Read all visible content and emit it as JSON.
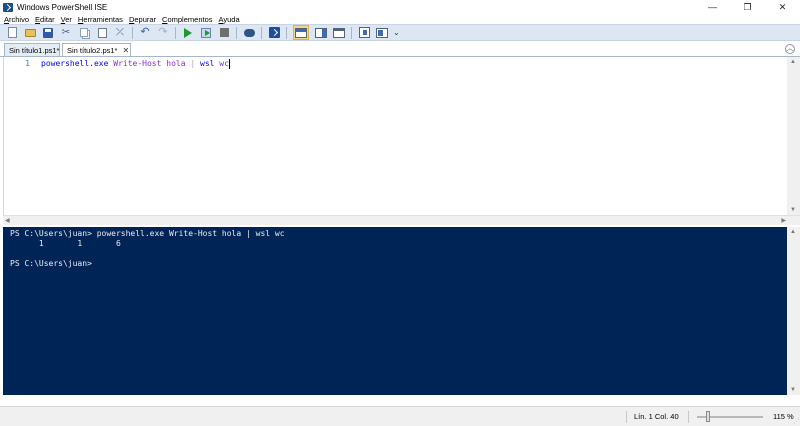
{
  "window": {
    "title": "Windows PowerShell ISE",
    "controls": [
      "—",
      "❐",
      "✕"
    ]
  },
  "menu": {
    "items": [
      {
        "underlined": "A",
        "rest": "rchivo"
      },
      {
        "underlined": "E",
        "rest": "ditar"
      },
      {
        "underlined": "V",
        "rest": "er"
      },
      {
        "underlined": "H",
        "rest": "erramientas"
      },
      {
        "underlined": "D",
        "rest": "epurar"
      },
      {
        "underlined": "C",
        "rest": "omplementos"
      },
      {
        "underlined": "A",
        "rest": "yuda"
      }
    ]
  },
  "toolbar": {
    "more": "⌄"
  },
  "tabs": [
    {
      "label": "Sin título1.ps1*",
      "active": false
    },
    {
      "label": "Sin título2.ps1*",
      "active": true,
      "close": "✕"
    }
  ],
  "collapse_glyph": "︿",
  "script": {
    "line_number": "1",
    "tokens": {
      "cmd1": "powershell.exe",
      "arg1": "Write-Host",
      "arg2": "hola",
      "pipe": "|",
      "cmd2": "wsl",
      "arg3": "wc"
    }
  },
  "console": {
    "lines": [
      "PS C:\\Users\\juan> powershell.exe Write-Host hola | wsl wc",
      "      1       1       6",
      "",
      "PS C:\\Users\\juan>"
    ]
  },
  "status": {
    "position": "Lín. 1  Col. 40",
    "zoom": "115 %",
    "zoom_level_percent": 115
  }
}
